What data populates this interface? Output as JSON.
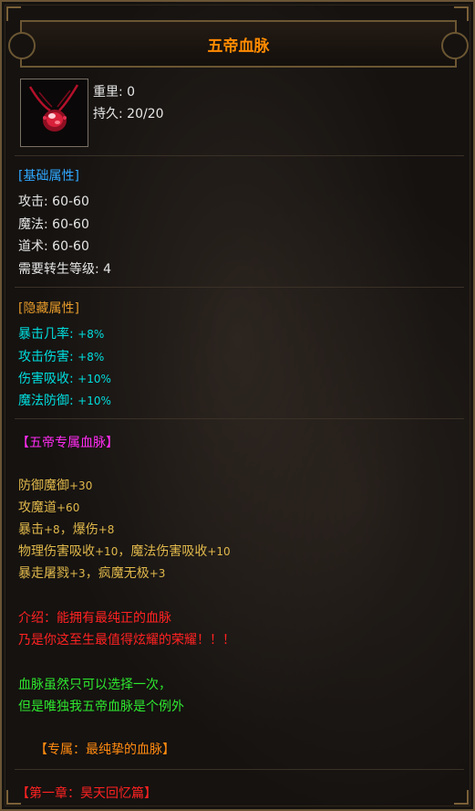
{
  "item": {
    "name": "五帝血脉",
    "weight_label": "重里:",
    "weight_value": "0",
    "durability_label": "持久:",
    "durability_value": "20/20"
  },
  "base_section": {
    "header": "[基础属性]",
    "attack_label": "攻击:",
    "attack_value": "60-60",
    "magic_label": "魔法:",
    "magic_value": "60-60",
    "taoism_label": "道术:",
    "taoism_value": "60-60",
    "rebirth_label": "需要转生等级:",
    "rebirth_value": "4"
  },
  "hidden_section": {
    "header": "[隐藏属性]",
    "crit_label": "暴击几率:",
    "crit_value": "+8%",
    "atkdmg_label": "攻击伤害:",
    "atkdmg_value": "+8%",
    "absorb_label": "伤害吸收:",
    "absorb_value": "+10%",
    "magdef_label": "魔法防御:",
    "magdef_value": "+10%"
  },
  "exclusive": {
    "header": "【五帝专属血脉】",
    "l1_name": "防御魔御",
    "l1_val": "+30",
    "l2_name": "攻魔道",
    "l2_val": "+60",
    "l3_a": "暴击",
    "l3_av": "+8",
    "l3_sep": "，爆伤",
    "l3_bv": "+8",
    "l4_a": "物理伤害吸收",
    "l4_av": "+10",
    "l4_sep": "，魔法伤害吸收",
    "l4_bv": "+10",
    "l5_a": "暴走屠戮",
    "l5_av": "+3",
    "l5_sep": "，疯魔无极",
    "l5_bv": "+3"
  },
  "description": {
    "red_line1": "介绍：能拥有最纯正的血脉",
    "red_line2": "乃是你这至生最值得炫耀的荣耀！！！",
    "green_line1": "血脉虽然只可以选择一次，",
    "green_line2": "但是唯独我五帝血脉是个例外",
    "exclusive_note": "【专属：最纯挚的血脉】",
    "chapter": "【第一章：昊天回忆篇】"
  },
  "colors": {
    "title": "#ff8a00",
    "section_blue": "#2fa8ff",
    "section_orange": "#e59a2a",
    "hidden_cyan": "#00dede",
    "exclusive_magenta": "#ff2cf2",
    "stat_gold": "#e0b84b",
    "intro_red": "#ff2222",
    "intro_green": "#2ee82e"
  }
}
